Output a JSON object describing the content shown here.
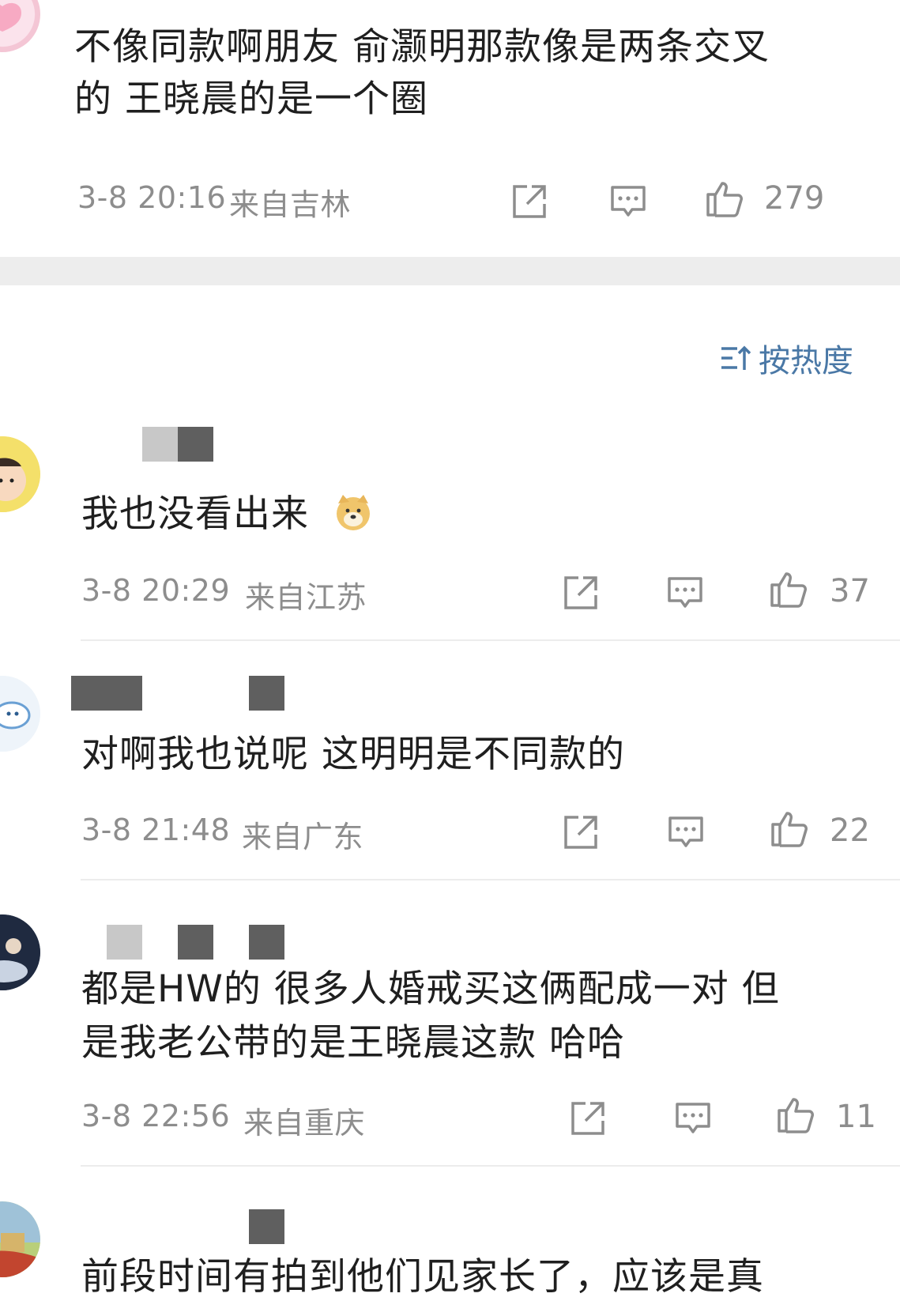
{
  "comments": [
    {
      "text_lines": [
        "不像同款啊朋友 俞灏明那款像是两条交叉",
        "的 王晓晨的是一个圈"
      ],
      "time": "3-8 20:16",
      "location": "来自吉林",
      "likes": "279"
    },
    {
      "text_lines": [
        "我也没看出来"
      ],
      "emoji": "doge",
      "time": "3-8 20:29",
      "location": "来自江苏",
      "likes": "37"
    },
    {
      "text_lines": [
        "对啊我也说呢  这明明是不同款的"
      ],
      "time": "3-8 21:48",
      "location": "来自广东",
      "likes": "22"
    },
    {
      "text_lines": [
        "都是HW的 很多人婚戒买这俩配成一对 但",
        "是我老公带的是王晓晨这款  哈哈"
      ],
      "time": "3-8 22:56",
      "location": "来自重庆",
      "likes": "11"
    },
    {
      "text_lines": [
        "前段时间有拍到他们见家长了，应该是真"
      ]
    }
  ],
  "sort_label": "按热度",
  "icons": {
    "share": "share-icon",
    "comment": "comment-icon",
    "like": "thumbs-up-icon",
    "sort": "sort-icon"
  },
  "colors": {
    "text": "#1f1f1f",
    "meta": "#8d8d8d",
    "sort_accent": "#4a78a6",
    "band": "#ededed"
  }
}
